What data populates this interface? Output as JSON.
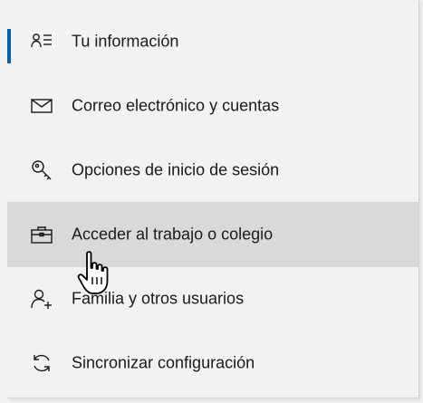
{
  "menu": {
    "items": [
      {
        "label": "Tu información",
        "icon": "person-list-icon"
      },
      {
        "label": "Correo electrónico y cuentas",
        "icon": "mail-icon"
      },
      {
        "label": "Opciones de inicio de sesión",
        "icon": "key-icon"
      },
      {
        "label": "Acceder al trabajo o colegio",
        "icon": "briefcase-icon"
      },
      {
        "label": "Familia y otros usuarios",
        "icon": "person-add-icon"
      },
      {
        "label": "Sincronizar configuración",
        "icon": "sync-icon"
      }
    ]
  },
  "colors": {
    "accent": "#0063b1",
    "hover_background": "#d9d9d9",
    "panel_background": "#f2f2f2",
    "text": "#1a1a1a"
  }
}
